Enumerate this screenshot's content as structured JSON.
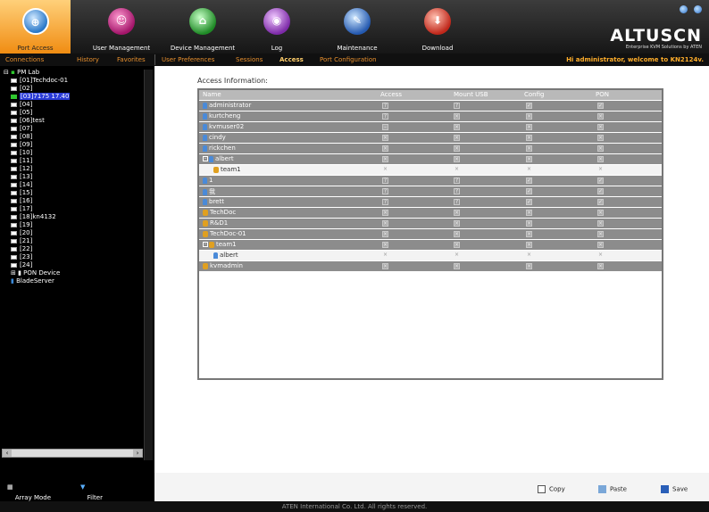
{
  "tabs": [
    {
      "label": "Port Access"
    },
    {
      "label": "User Management"
    },
    {
      "label": "Device Management"
    },
    {
      "label": "Log"
    },
    {
      "label": "Maintenance"
    },
    {
      "label": "Download"
    }
  ],
  "brand": {
    "name": "ALTUSCN",
    "tagline": "Enterprise KVM Solutions by ATEN"
  },
  "subtabs": {
    "connections": "Connections",
    "history": "History",
    "favorites": "Favorites",
    "user_preferences": "User Preferences",
    "sessions": "Sessions",
    "access": "Access",
    "port_configuration": "Port Configuration",
    "welcome": "Hi administrator, welcome to KN2124v."
  },
  "sidebar": {
    "root": "PM Lab",
    "ports": [
      "[01]Techdoc-01",
      "[02]",
      "[03]7175 17.40",
      "[04]",
      "[05]",
      "[06]test",
      "[07]",
      "[08]",
      "[09]",
      "[10]",
      "[11]",
      "[12]",
      "[13]",
      "[14]",
      "[15]",
      "[16]",
      "[17]",
      "[18]kn4132",
      "[19]",
      "[20]",
      "[21]",
      "[22]",
      "[23]",
      "[24]"
    ],
    "selected_index": 2,
    "active_index": 2,
    "extra": [
      "PON Device",
      "BladeServer"
    ],
    "footer": {
      "array_mode": "Array Mode",
      "filter": "Filter"
    }
  },
  "access": {
    "title": "Access Information:",
    "columns": [
      "Name",
      "Access",
      "Mount USB",
      "Config",
      "PON"
    ],
    "rows": [
      {
        "name": "administrator",
        "kind": "user",
        "level": 0,
        "checks": [
          "?",
          "?",
          "c",
          "c"
        ]
      },
      {
        "name": "kurtcheng",
        "kind": "user",
        "level": 0,
        "checks": [
          "?",
          "x",
          "x",
          "x"
        ]
      },
      {
        "name": "kvmuser02",
        "kind": "user",
        "level": 0,
        "checks": [
          "-",
          "x",
          "x",
          "x"
        ]
      },
      {
        "name": "cindy",
        "kind": "user",
        "level": 0,
        "checks": [
          "x",
          "x",
          "x",
          "x"
        ]
      },
      {
        "name": "rickchen",
        "kind": "user",
        "level": 0,
        "checks": [
          "x",
          "x",
          "x",
          "x"
        ]
      },
      {
        "name": "albert",
        "kind": "user",
        "level": 0,
        "expand": true,
        "checks": [
          "x",
          "x",
          "x",
          "x"
        ]
      },
      {
        "name": "team1",
        "kind": "group",
        "level": 1,
        "checks": [
          "x",
          "x",
          "x",
          "x"
        ]
      },
      {
        "name": "1",
        "kind": "user",
        "level": 0,
        "checks": [
          "?",
          "?",
          "c",
          "c"
        ]
      },
      {
        "name": "我",
        "kind": "user",
        "level": 0,
        "checks": [
          "?",
          "?",
          "c",
          "c"
        ]
      },
      {
        "name": "brett",
        "kind": "user",
        "level": 0,
        "checks": [
          "?",
          "?",
          "c",
          "c"
        ]
      },
      {
        "name": "TechDoc",
        "kind": "group",
        "level": 0,
        "checks": [
          "x",
          "x",
          "x",
          "x"
        ]
      },
      {
        "name": "R&D1",
        "kind": "group",
        "level": 0,
        "checks": [
          "x",
          "x",
          "x",
          "x"
        ]
      },
      {
        "name": "TechDoc-01",
        "kind": "group",
        "level": 0,
        "checks": [
          "x",
          "x",
          "x",
          "x"
        ]
      },
      {
        "name": "team1",
        "kind": "group",
        "level": 0,
        "expand": true,
        "checks": [
          "x",
          "x",
          "x",
          "x"
        ]
      },
      {
        "name": "albert",
        "kind": "user",
        "level": 1,
        "checks": [
          "x",
          "x",
          "x",
          "x"
        ]
      },
      {
        "name": "kvmadmin",
        "kind": "group",
        "level": 0,
        "checks": [
          "x",
          "x",
          "x",
          "x"
        ]
      }
    ]
  },
  "buttons": {
    "copy": "Copy",
    "paste": "Paste",
    "save": "Save"
  },
  "footer": {
    "copyright": "ATEN International Co. Ltd. All rights reserved."
  }
}
